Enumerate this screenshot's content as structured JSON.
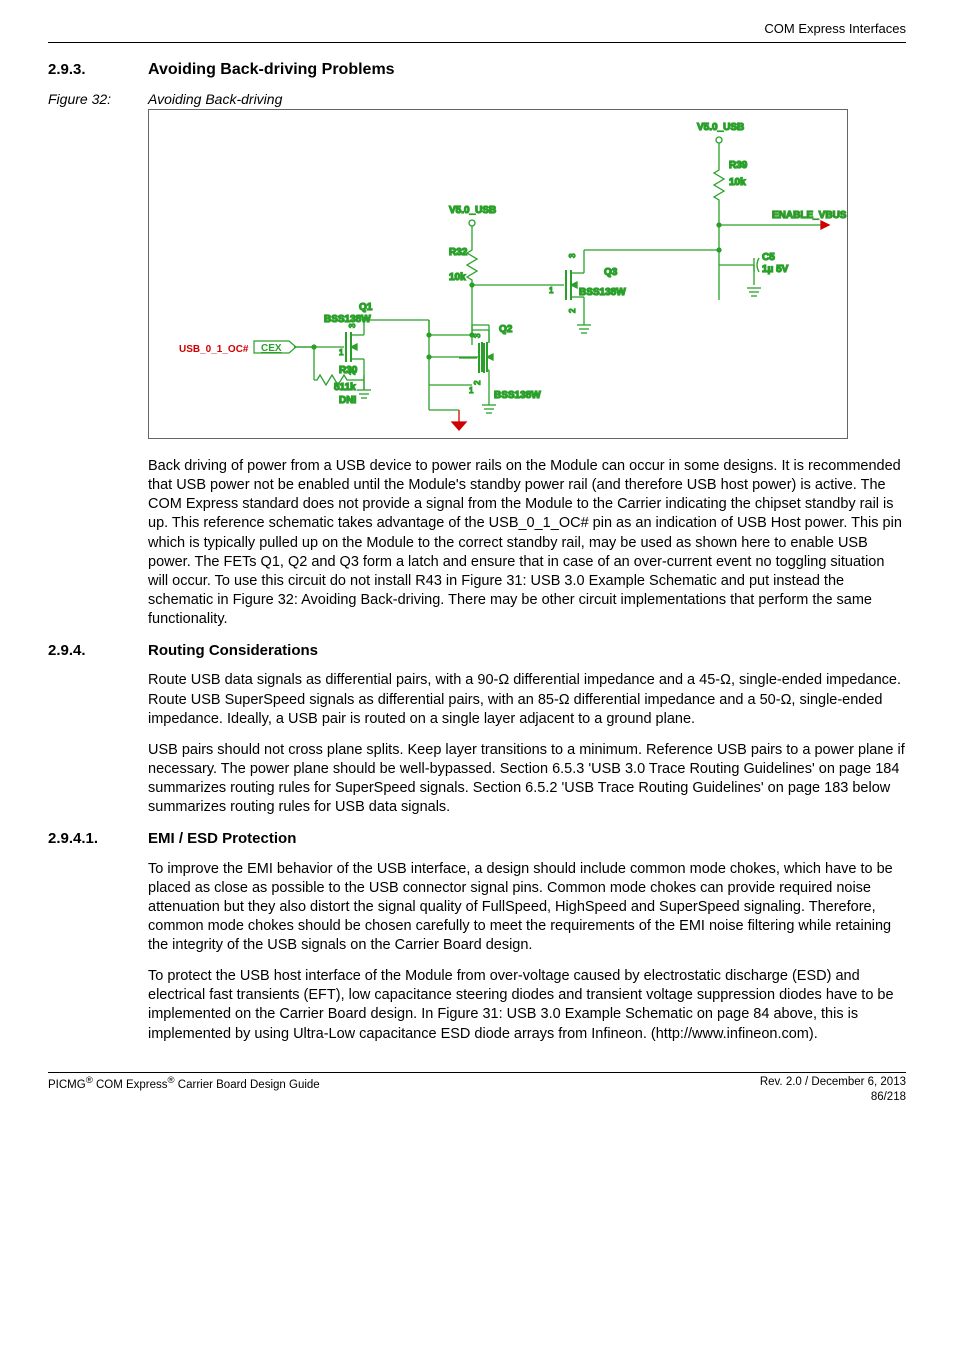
{
  "header": {
    "chapter": "COM Express Interfaces"
  },
  "section293": {
    "number": "2.9.3.",
    "title": "Avoiding Back-driving Problems"
  },
  "figure32": {
    "label": "Figure 32:",
    "title": "Avoiding Back-driving"
  },
  "diagram": {
    "v50_usb_top": "V5.0_USB",
    "r39": "R39",
    "r39_val": "10k",
    "enable_vbus": "ENABLE_VBUS",
    "v50_usb_mid": "V5.0_USB",
    "r32": "R32",
    "r32_val": "10k",
    "c5": "C5",
    "c5_val": "1µ  5V",
    "q1": "Q1",
    "q1_part": "BSS138W",
    "q2": "Q2",
    "q2_part": "BSS138W",
    "q3": "Q3",
    "q3_part": "BSS138W",
    "r30": "R30",
    "r30_val": "511k",
    "dni": "DNI",
    "usb_oc": "USB_0_1_OC#",
    "cex": "CEX"
  },
  "para293": "Back driving of power from a USB device to power rails on the Module can occur in some designs.  It is recommended that USB power not be enabled until the Module's standby power rail (and therefore USB host power) is active.  The COM Express standard does not provide a signal from the Module to the Carrier indicating the chipset standby rail is up.  This reference schematic takes advantage of the USB_0_1_OC# pin as an indication of USB Host power.  This pin which is typically pulled up on the Module to the correct standby rail, may be used as shown here to enable USB power.  The FETs Q1, Q2 and Q3 form a latch and ensure that in case of an over-current event no toggling situation will occur.  To use this circuit do not install R43 in Figure 31: USB 3.0 Example Schematic and put instead the schematic in Figure 32: Avoiding Back-driving.  There may be other circuit implementations that perform the same functionality.",
  "section294": {
    "number": "2.9.4.",
    "title": "Routing Considerations"
  },
  "para294a": "Route USB data signals as differential pairs, with a 90-Ω differential impedance and a 45-Ω, single-ended impedance.  Route USB SuperSpeed signals as differential pairs, with an 85-Ω differential impedance and a 50-Ω, single-ended impedance.  Ideally, a USB pair is routed on a single layer adjacent to a ground plane.",
  "para294b": "USB pairs should not cross plane splits.  Keep layer transitions to a minimum.  Reference USB pairs to a power plane if necessary.  The power plane should be well-bypassed.  Section 6.5.3 'USB 3.0 Trace Routing Guidelines' on page 184 summarizes routing rules for SuperSpeed signals.  Section 6.5.2 'USB Trace Routing Guidelines' on page 183 below summarizes routing rules for USB data signals.",
  "section2941": {
    "number": "2.9.4.1.",
    "title": "EMI / ESD Protection"
  },
  "para2941a": "To improve the EMI behavior of the USB interface, a design should include common mode chokes, which have to be placed as close as possible to the USB connector signal pins. Common mode chokes can provide required noise attenuation but they also distort the signal quality of FullSpeed, HighSpeed and SuperSpeed signaling.  Therefore, common mode chokes should be chosen carefully to meet the requirements of the EMI noise filtering while retaining the integrity of the USB signals on the Carrier Board design.",
  "para2941b": "To protect the USB host interface of the Module from over-voltage caused by electrostatic discharge (ESD) and electrical fast transients (EFT), low capacitance steering diodes and transient voltage suppression diodes have to be implemented on the Carrier Board design.  In Figure 31: USB 3.0 Example Schematic on page 84 above, this is implemented by using Ultra-Low capacitance ESD diode arrays from Infineon. (http://www.infineon.com).",
  "footer": {
    "left_prefix": "PICMG",
    "left_mid": " COM Express",
    "left_suffix": " Carrier Board Design Guide",
    "right_rev": "Rev. 2.0 / December 6, 2013",
    "right_page": "86/218"
  }
}
